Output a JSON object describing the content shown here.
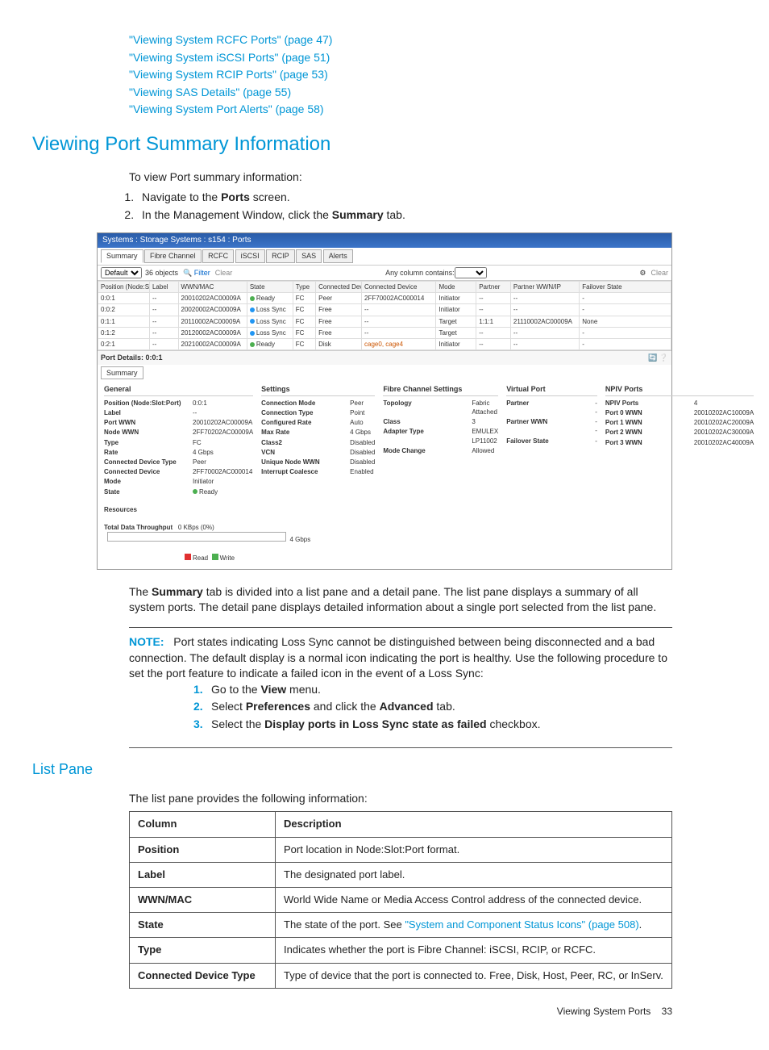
{
  "toc": [
    {
      "text": "\"Viewing System RCFC Ports\" (page 47)"
    },
    {
      "text": "\"Viewing System iSCSI Ports\" (page 51)"
    },
    {
      "text": "\"Viewing System RCIP Ports\" (page 53)"
    },
    {
      "text": "\"Viewing SAS Details\" (page 55)"
    },
    {
      "text": "\"Viewing System Port Alerts\" (page 58)"
    }
  ],
  "section_title": "Viewing Port Summary Information",
  "intro": "To view Port summary information:",
  "steps1": [
    {
      "pre": "Navigate to the ",
      "b": "Ports",
      "post": " screen."
    },
    {
      "pre": "In the Management Window, click the ",
      "b": "Summary",
      "post": " tab."
    }
  ],
  "screenshot": {
    "titlebar": "Systems : Storage Systems : s154 : Ports",
    "tabs": [
      "Summary",
      "Fibre Channel",
      "RCFC",
      "iSCSI",
      "RCIP",
      "SAS",
      "Alerts"
    ],
    "filter": {
      "default": "Default",
      "objects": "36 objects",
      "filter": "Filter",
      "clear": "Clear",
      "anycol": "Any column contains:"
    },
    "headers": [
      "Position (Node:Slot:Port)",
      "Label",
      "WWN/MAC",
      "State",
      "Type",
      "Connected Device Type",
      "Connected Device",
      "Mode",
      "Partner",
      "Partner WWN/IP",
      "Failover State"
    ],
    "rows": [
      {
        "pos": "0:0:1",
        "label": "--",
        "wwn": "20010202AC00009A",
        "state": "Ready",
        "dot": "g",
        "type": "FC",
        "cdt": "Peer",
        "cd": "2FF70002AC000014",
        "mode": "Initiator",
        "partner": "--",
        "pwwn": "--",
        "fo": "-"
      },
      {
        "pos": "0:0:2",
        "label": "--",
        "wwn": "20020002AC00009A",
        "state": "Loss Sync",
        "dot": "b",
        "type": "FC",
        "cdt": "Free",
        "cd": "--",
        "mode": "Initiator",
        "partner": "--",
        "pwwn": "--",
        "fo": "-"
      },
      {
        "pos": "0:1:1",
        "label": "--",
        "wwn": "20110002AC00009A",
        "state": "Loss Sync",
        "dot": "b",
        "type": "FC",
        "cdt": "Free",
        "cd": "--",
        "mode": "Target",
        "partner": "1:1:1",
        "pwwn": "21110002AC00009A",
        "fo": "None"
      },
      {
        "pos": "0:1:2",
        "label": "--",
        "wwn": "20120002AC00009A",
        "state": "Loss Sync",
        "dot": "b",
        "type": "FC",
        "cdt": "Free",
        "cd": "--",
        "mode": "Target",
        "partner": "--",
        "pwwn": "--",
        "fo": "-"
      },
      {
        "pos": "0:2:1",
        "label": "--",
        "wwn": "20210002AC00009A",
        "state": "Ready",
        "dot": "g",
        "type": "FC",
        "cdt": "Disk",
        "cd": "cage0, cage4",
        "mode": "Initiator",
        "partner": "--",
        "pwwn": "--",
        "fo": "-"
      }
    ],
    "port_details_label": "Port Details: 0:0:1",
    "subtab": "Summary",
    "detail": {
      "general": {
        "h": "General",
        "items": [
          {
            "k": "Position (Node:Slot:Port)",
            "v": "0:0:1"
          },
          {
            "k": "Label",
            "v": "--"
          },
          {
            "k": "Port WWN",
            "v": "20010202AC00009A"
          },
          {
            "k": "Node WWN",
            "v": "2FF70202AC00009A"
          },
          {
            "k": "Type",
            "v": "FC"
          },
          {
            "k": "Rate",
            "v": "4 Gbps"
          },
          {
            "k": "Connected Device Type",
            "v": "Peer"
          },
          {
            "k": "Connected Device",
            "v": "2FF70002AC000014"
          },
          {
            "k": "Mode",
            "v": "Initiator"
          },
          {
            "k": "State",
            "v": "Ready"
          }
        ]
      },
      "settings": {
        "h": "Settings",
        "items": [
          {
            "k": "Connection Mode",
            "v": "Peer"
          },
          {
            "k": "Connection Type",
            "v": "Point"
          },
          {
            "k": "Configured Rate",
            "v": "Auto"
          },
          {
            "k": "Max Rate",
            "v": "4 Gbps"
          },
          {
            "k": "Class2",
            "v": "Disabled"
          },
          {
            "k": "VCN",
            "v": "Disabled"
          },
          {
            "k": "Unique Node WWN",
            "v": "Disabled"
          },
          {
            "k": "Interrupt Coalesce",
            "v": "Enabled"
          }
        ]
      },
      "fc": {
        "h": "Fibre Channel Settings",
        "items": [
          {
            "k": "Topology",
            "v": "Fabric Attached"
          },
          {
            "k": "Class",
            "v": "3"
          },
          {
            "k": "Adapter Type",
            "v": "EMULEX LP11002"
          },
          {
            "k": "Mode Change",
            "v": "Allowed"
          }
        ]
      },
      "virtual": {
        "h": "Virtual Port",
        "items": [
          {
            "k": "Partner",
            "v": "--"
          },
          {
            "k": "Partner WWN",
            "v": "--"
          },
          {
            "k": "Failover State",
            "v": "-"
          }
        ]
      },
      "npiv": {
        "h": "NPIV Ports",
        "items": [
          {
            "k": "NPIV Ports",
            "v": "4"
          },
          {
            "k": "Port 0 WWN",
            "v": "20010202AC10009A"
          },
          {
            "k": "Port 1 WWN",
            "v": "20010202AC20009A"
          },
          {
            "k": "Port 2 WWN",
            "v": "20010202AC30009A"
          },
          {
            "k": "Port 3 WWN",
            "v": "20010202AC40009A"
          }
        ]
      }
    },
    "resources": "Resources",
    "throughput_label": "Total Data Throughput",
    "throughput_val": "0 KBps (0%)",
    "throughput_rate": "4 Gbps",
    "legend_read": "Read",
    "legend_write": "Write"
  },
  "para1_a": "The ",
  "para1_b": "Summary",
  "para1_c": " tab is divided into a list pane and a detail pane. The list pane displays a summary of all system ports. The detail pane displays detailed information about a single port selected from the list pane.",
  "note_label": "NOTE:",
  "note_body": "Port states indicating Loss Sync cannot be distinguished between being disconnected and a bad connection. The default display is a normal icon indicating the port is healthy. Use the following procedure to set the port feature to indicate a failed icon in the event of a Loss Sync:",
  "steps2": [
    {
      "parts": [
        "Go to the ",
        "View",
        " menu."
      ]
    },
    {
      "parts": [
        "Select ",
        "Preferences",
        " and click the ",
        "Advanced",
        " tab."
      ]
    },
    {
      "parts": [
        "Select the ",
        "Display ports in Loss Sync state as failed",
        " checkbox."
      ]
    }
  ],
  "listpane_h": "List Pane",
  "listpane_intro": "The list pane provides the following information:",
  "table": {
    "headers": [
      "Column",
      "Description"
    ],
    "rows": [
      {
        "c": "Position",
        "d": "Port location in Node:Slot:Port format."
      },
      {
        "c": "Label",
        "d": "The designated port label."
      },
      {
        "c": "WWN/MAC",
        "d": "World Wide Name or Media Access Control address of the connected device."
      },
      {
        "c": "State",
        "d": "The state of the port. See ",
        "link": "\"System and Component Status Icons\" (page 508)",
        "post": "."
      },
      {
        "c": "Type",
        "d": "Indicates whether the port is Fibre Channel: iSCSI, RCIP, or RCFC."
      },
      {
        "c": "Connected Device Type",
        "d": "Type of device that the port is connected to. Free, Disk, Host, Peer, RC, or InServ."
      }
    ]
  },
  "footer_text": "Viewing System Ports",
  "footer_page": "33"
}
